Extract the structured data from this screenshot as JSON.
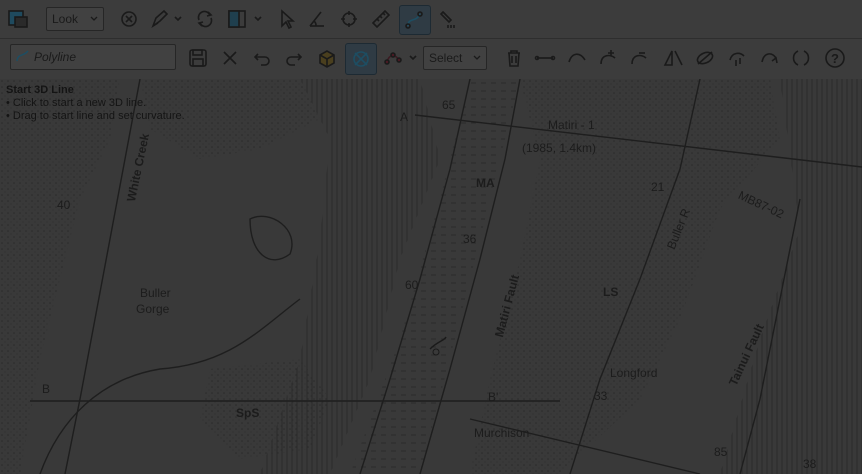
{
  "toolbar_top": {
    "view_select": "Look"
  },
  "toolbar_edit": {
    "object_input_placeholder": "Polyline",
    "mode_select": "Select",
    "help_label": "?"
  },
  "hint": {
    "title": "Start 3D Line",
    "line1": "• Click to start a new 3D line.",
    "line2": "• Drag to start line and set curvature."
  },
  "map_labels": {
    "matiri": "Matiri - 1",
    "matiri_info": "(1985, 1.4km)",
    "white_creek": "White Creek",
    "buller_gorge_1": "Buller",
    "buller_gorge_2": "Gorge",
    "ma": "MA",
    "ls": "LS",
    "sps": "SpS",
    "longford": "Longford",
    "murchison": "Murchison",
    "matiri_fault": "Matiri Fault",
    "tainui_fault": "Tainui Fault",
    "buller_r": "Buller R",
    "mb": "MB87-02",
    "lbl_40": "40",
    "lbl_65": "65",
    "lbl_36": "36",
    "lbl_60": "60",
    "lbl_33": "33",
    "lbl_21": "21",
    "lbl_85": "85",
    "lbl_38": "38",
    "lbl_a": "A",
    "lbl_b": "B",
    "lbl_b2": "B'"
  }
}
